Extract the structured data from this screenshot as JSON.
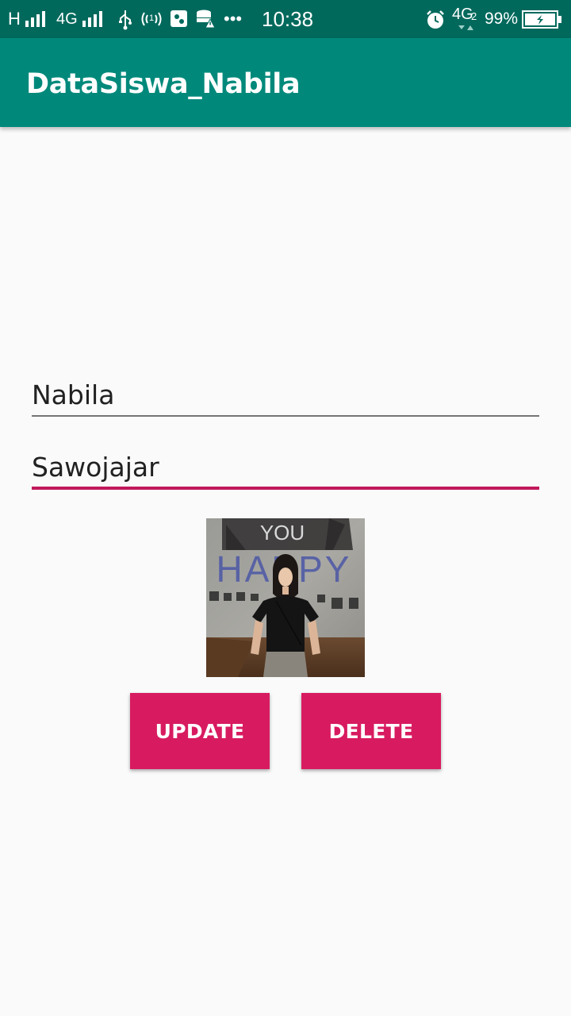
{
  "status_bar": {
    "carrier_signal_1": "H",
    "carrier_signal_2": "4G",
    "more_indicator": "•••",
    "time": "10:38",
    "network_type": "4G",
    "network_sub": "2",
    "battery_percent": "99%"
  },
  "app": {
    "title": "DataSiswa_Nabila"
  },
  "form": {
    "name_value": "Nabila",
    "address_value": "Sawojajar"
  },
  "photo": {
    "wall_text_top": "YOU",
    "wall_text_main": "HAPPY"
  },
  "buttons": {
    "update_label": "UPDATE",
    "delete_label": "DELETE"
  },
  "colors": {
    "status_bar": "#00695c",
    "app_bar": "#00897b",
    "accent": "#d81b60",
    "focus_underline": "#c2185b",
    "background": "#fafafa"
  }
}
